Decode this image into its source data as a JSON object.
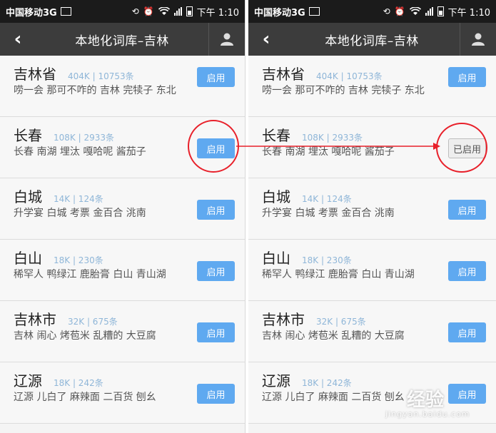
{
  "status_bar": {
    "carrier": "中国移动3G",
    "time": "下午 1:10",
    "network": "3G"
  },
  "nav": {
    "title": "本地化词库–吉林"
  },
  "buttons": {
    "enable": "启用",
    "enabled": "已启用"
  },
  "items": [
    {
      "name": "吉林省",
      "meta": "404K | 10753条",
      "words": "唠一会 那可不咋的 吉林 完犊子 东北"
    },
    {
      "name": "长春",
      "meta": "108K | 2933条",
      "words": "长春 南湖 埋汰 嘎哈呢 酱茄子"
    },
    {
      "name": "白城",
      "meta": "14K | 124条",
      "words": "升学宴 白城 考票 金百合 洮南"
    },
    {
      "name": "白山",
      "meta": "18K | 230条",
      "words": "稀罕人 鸭绿江 鹿胎膏 白山 青山湖"
    },
    {
      "name": "吉林市",
      "meta": "32K | 675条",
      "words": "吉林 闹心 烤苞米 乱糟的 大豆腐"
    },
    {
      "name": "辽源",
      "meta": "18K | 242条",
      "words": "辽源 儿白了 麻辣面 二百货 刨幺"
    }
  ],
  "watermark": {
    "text": "经验",
    "site": "jingyan.baidu.com"
  },
  "colors": {
    "accent": "#5fa9f0",
    "highlight": "#e8202a",
    "nav_bg": "#3c3c3c"
  },
  "icons": [
    "back-arrow-icon",
    "user-icon",
    "wifi-icon",
    "alarm-icon",
    "signal-icon",
    "battery-icon"
  ]
}
